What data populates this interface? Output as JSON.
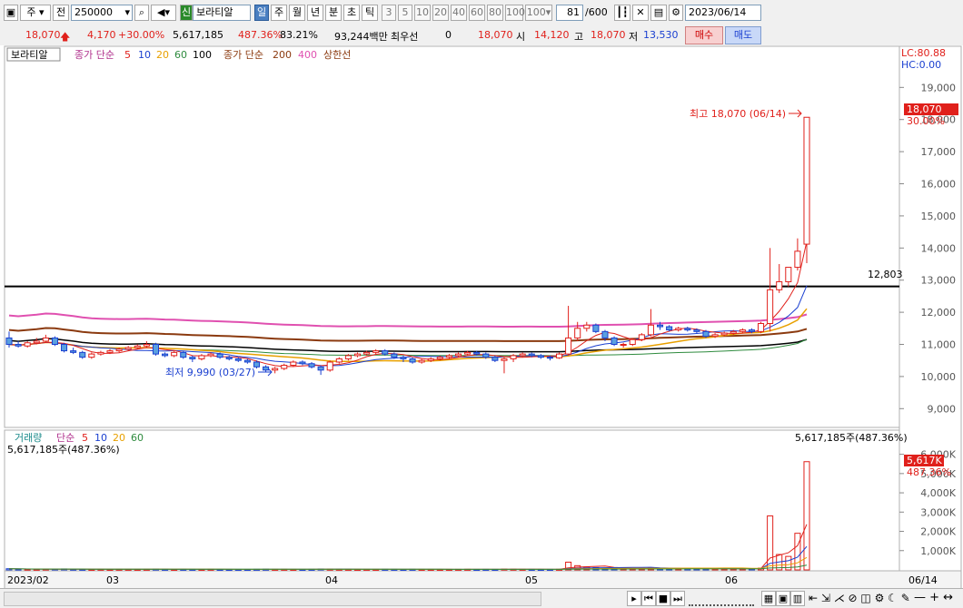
{
  "toolbar": {
    "period_main": "주",
    "period_prev": "전",
    "stock_code": "250000",
    "stock_badge": "신",
    "stock_name": "보라티알",
    "periods": [
      "일",
      "주",
      "월",
      "년",
      "분",
      "초",
      "틱"
    ],
    "active_period": "일",
    "minute_options": [
      "3",
      "5",
      "10",
      "20",
      "40",
      "60",
      "80",
      "100"
    ],
    "minute_select": "100",
    "bar_count": "81",
    "bar_total": "/600",
    "date": "2023/06/14"
  },
  "quote": {
    "price": "18,070",
    "change": "4,170",
    "change_pct": "+30.00%",
    "volume": "5,617,185",
    "volume_ratio": "487.36%",
    "turnover": "83.21%",
    "amount": "93,244백만",
    "pref_label": "최우선",
    "pref_value": "0",
    "best": "18,070",
    "open_label": "시",
    "open": "14,120",
    "high_label": "고",
    "high": "18,070",
    "low_label": "저",
    "low": "13,530",
    "buy_label": "매수",
    "sell_label": "매도"
  },
  "price_panel": {
    "legend": {
      "name": "보라티알",
      "ma_label": "종가 단순",
      "ma_periods": [
        {
          "label": "5",
          "color": "#e0201b"
        },
        {
          "label": "10",
          "color": "#1a3fd0"
        },
        {
          "label": "20",
          "color": "#e8a000"
        },
        {
          "label": "60",
          "color": "#2e8b3e"
        },
        {
          "label": "100",
          "color": "#000000"
        }
      ],
      "ma2_label": "종가 단순",
      "ma2_periods": [
        {
          "label": "200",
          "color": "#8b3a0f"
        },
        {
          "label": "400",
          "color": "#e050b0"
        }
      ],
      "limit_label": "상한선"
    },
    "lc": "LC:80.88",
    "hc": "HC:0.00",
    "y_ticks": [
      "19,000",
      "18,000",
      "17,000",
      "16,000",
      "15,000",
      "14,000",
      "13,000",
      "12,000",
      "11,000",
      "10,000",
      "9,000"
    ],
    "current_price_tag": "18,070",
    "current_pct_tag": "30.00%",
    "high_annotation": "최고 18,070 (06/14)",
    "low_annotation": "최저 9,990 (03/27)",
    "hline_value": "12,803"
  },
  "volume_panel": {
    "legend_name": "거래량",
    "legend_ma": "단순",
    "ma_periods": [
      {
        "label": "5",
        "color": "#e0201b"
      },
      {
        "label": "10",
        "color": "#1a3fd0"
      },
      {
        "label": "20",
        "color": "#e8a000"
      },
      {
        "label": "60",
        "color": "#2e8b3e"
      }
    ],
    "left_value": "5,617,185주(487.36%)",
    "right_value": "5,617,185주(487.36%)",
    "y_ticks": [
      "6,000K",
      "5,000K",
      "4,000K",
      "3,000K",
      "2,000K",
      "1,000K"
    ],
    "current_tag": "5,617K",
    "current_pct": "487.36%"
  },
  "x_axis": {
    "labels": [
      "2023/02",
      "03",
      "04",
      "05",
      "06"
    ],
    "end_label": "06/14"
  },
  "chart_data": {
    "type": "candlestick",
    "title": "보라티알",
    "ylim": [
      8500,
      19800
    ],
    "x": [
      "02-06",
      "02-07",
      "02-08",
      "02-09",
      "02-10",
      "02-13",
      "02-14",
      "02-15",
      "02-16",
      "02-17",
      "02-20",
      "02-21",
      "02-22",
      "02-23",
      "02-24",
      "02-27",
      "02-28",
      "03-02",
      "03-03",
      "03-06",
      "03-07",
      "03-08",
      "03-09",
      "03-10",
      "03-13",
      "03-14",
      "03-15",
      "03-16",
      "03-17",
      "03-20",
      "03-21",
      "03-22",
      "03-23",
      "03-24",
      "03-27",
      "03-28",
      "03-29",
      "03-30",
      "03-31",
      "04-03",
      "04-04",
      "04-05",
      "04-06",
      "04-07",
      "04-10",
      "04-11",
      "04-12",
      "04-13",
      "04-14",
      "04-17",
      "04-18",
      "04-19",
      "04-20",
      "04-21",
      "04-24",
      "04-25",
      "04-26",
      "04-27",
      "04-28",
      "05-02",
      "05-03",
      "05-04",
      "05-08",
      "05-09",
      "05-10",
      "05-11",
      "05-12",
      "05-15",
      "05-16",
      "05-17",
      "05-18",
      "05-19",
      "05-22",
      "05-23",
      "05-24",
      "05-25",
      "05-26",
      "05-30",
      "05-31",
      "06-01",
      "06-02",
      "06-05",
      "06-07",
      "06-08",
      "06-09",
      "06-12",
      "06-13",
      "06-14"
    ],
    "open": [
      11200,
      11000,
      10950,
      11050,
      11100,
      11200,
      11000,
      10800,
      10750,
      10600,
      10700,
      10750,
      10800,
      10850,
      10900,
      10950,
      11000,
      10700,
      10650,
      10750,
      10600,
      10550,
      10650,
      10700,
      10600,
      10550,
      10500,
      10450,
      10300,
      10200,
      10250,
      10350,
      10450,
      10400,
      10300,
      10200,
      10450,
      10550,
      10650,
      10700,
      10750,
      10800,
      10700,
      10600,
      10550,
      10450,
      10500,
      10550,
      10600,
      10650,
      10700,
      10750,
      10700,
      10600,
      10500,
      10550,
      10650,
      10700,
      10650,
      10600,
      10580,
      10700,
      11200,
      11500,
      11600,
      11400,
      11200,
      11000,
      11000,
      11150,
      11300,
      11600,
      11550,
      11450,
      11500,
      11450,
      11400,
      11250,
      11300,
      11350,
      11400,
      11450,
      11400,
      11650,
      12700,
      12950,
      13400,
      14120
    ],
    "close": [
      11000,
      10950,
      11050,
      11100,
      11200,
      11000,
      10800,
      10750,
      10600,
      10700,
      10750,
      10800,
      10850,
      10900,
      10950,
      11000,
      10700,
      10650,
      10750,
      10600,
      10550,
      10650,
      10700,
      10600,
      10550,
      10500,
      10450,
      10300,
      10200,
      10250,
      10350,
      10450,
      10400,
      10300,
      10200,
      10450,
      10550,
      10650,
      10700,
      10750,
      10800,
      10700,
      10600,
      10550,
      10450,
      10500,
      10550,
      10600,
      10650,
      10700,
      10750,
      10700,
      10600,
      10500,
      10550,
      10650,
      10700,
      10650,
      10600,
      10580,
      10700,
      11200,
      11500,
      11600,
      11400,
      11200,
      11000,
      11000,
      11150,
      11300,
      11600,
      11550,
      11450,
      11500,
      11450,
      11400,
      11250,
      11300,
      11350,
      11400,
      11450,
      11400,
      11650,
      12700,
      12950,
      13400,
      13900,
      18070
    ],
    "high": [
      11400,
      11100,
      11100,
      11200,
      11300,
      11250,
      11050,
      10900,
      10800,
      10750,
      10800,
      10850,
      10900,
      10950,
      11000,
      11100,
      11050,
      10750,
      10800,
      10800,
      10650,
      10700,
      10750,
      10750,
      10650,
      10600,
      10550,
      10500,
      10350,
      10300,
      10400,
      10500,
      10500,
      10450,
      10350,
      10500,
      10600,
      10700,
      10750,
      10800,
      10850,
      10850,
      10750,
      10650,
      10600,
      10550,
      10600,
      10650,
      10700,
      10750,
      10800,
      10800,
      10750,
      10650,
      10600,
      10700,
      10750,
      10750,
      10700,
      10650,
      10750,
      12200,
      11700,
      11700,
      11650,
      11450,
      11250,
      11050,
      11200,
      11350,
      12100,
      11700,
      11600,
      11550,
      11550,
      11500,
      11450,
      11350,
      11400,
      11450,
      11500,
      11500,
      11700,
      14000,
      13500,
      13200,
      14300,
      18070
    ],
    "low": [
      10900,
      10900,
      10900,
      11000,
      11050,
      10950,
      10750,
      10700,
      10550,
      10550,
      10650,
      10700,
      10750,
      10800,
      10850,
      10900,
      10650,
      10600,
      10600,
      10550,
      10450,
      10500,
      10600,
      10550,
      10500,
      10450,
      10400,
      10250,
      10150,
      10100,
      10200,
      10300,
      10350,
      10250,
      10050,
      10150,
      10400,
      10500,
      10600,
      10650,
      10700,
      10650,
      10550,
      10450,
      10400,
      10400,
      10450,
      10500,
      10550,
      10600,
      10650,
      10650,
      10550,
      10450,
      10100,
      10450,
      10600,
      10600,
      10550,
      10500,
      10550,
      10650,
      11100,
      11400,
      11350,
      11100,
      10950,
      10900,
      10950,
      11100,
      11250,
      11450,
      11400,
      11400,
      11400,
      11350,
      11200,
      11200,
      11250,
      11300,
      11350,
      11350,
      11350,
      11400,
      12600,
      12800,
      13300,
      13530
    ],
    "volume_k": [
      60,
      40,
      35,
      30,
      40,
      45,
      50,
      35,
      30,
      25,
      30,
      25,
      30,
      28,
      26,
      30,
      40,
      30,
      25,
      30,
      28,
      25,
      30,
      25,
      22,
      25,
      24,
      30,
      35,
      28,
      30,
      26,
      25,
      28,
      45,
      35,
      30,
      28,
      25,
      28,
      26,
      30,
      28,
      25,
      30,
      26,
      25,
      24,
      26,
      28,
      30,
      25,
      28,
      26,
      40,
      35,
      30,
      28,
      25,
      26,
      30,
      400,
      220,
      150,
      120,
      90,
      80,
      70,
      75,
      80,
      100,
      85,
      70,
      65,
      60,
      55,
      60,
      58,
      55,
      60,
      65,
      70,
      90,
      2800,
      800,
      700,
      1900,
      5617
    ]
  }
}
